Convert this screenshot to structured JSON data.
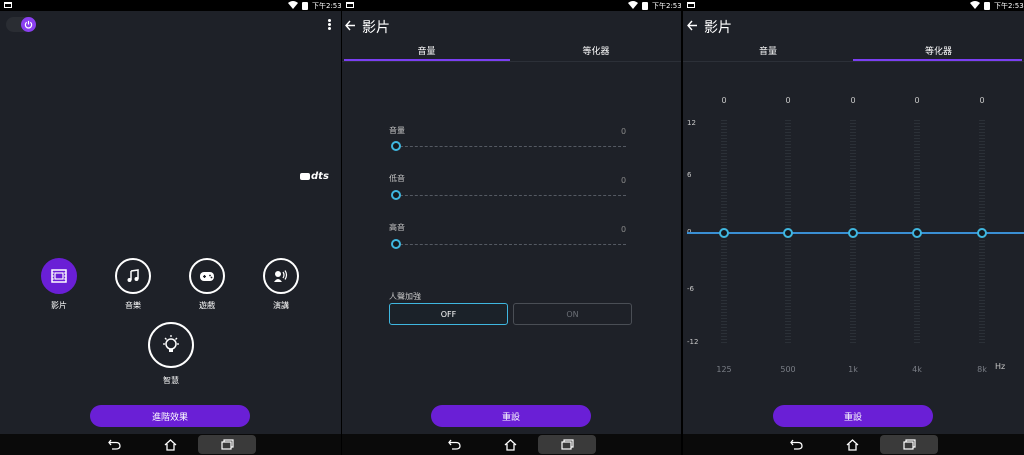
{
  "status": {
    "time": "下午2:53"
  },
  "accent": "#6a1fd6",
  "panel1": {
    "logo": "dts",
    "apps": [
      {
        "label": "影片",
        "icon": "film-icon"
      },
      {
        "label": "音樂",
        "icon": "music-note-icon"
      },
      {
        "label": "遊戲",
        "icon": "gamepad-icon"
      },
      {
        "label": "演講",
        "icon": "speaker-voice-icon"
      },
      {
        "label": "智慧",
        "icon": "lightbulb-icon"
      }
    ],
    "advanced_button": "進階效果"
  },
  "panel2": {
    "title": "影片",
    "tabs": [
      {
        "label": "音量"
      },
      {
        "label": "等化器"
      }
    ],
    "sliders": [
      {
        "label": "音量",
        "value": "0"
      },
      {
        "label": "低音",
        "value": "0"
      },
      {
        "label": "高音",
        "value": "0"
      }
    ],
    "voice_enhance": {
      "label": "人聲加強",
      "off": "OFF",
      "on": "ON"
    },
    "reset_button": "重設"
  },
  "panel3": {
    "title": "影片",
    "tabs": [
      {
        "label": "音量"
      },
      {
        "label": "等化器"
      }
    ],
    "eq_values": [
      "0",
      "0",
      "0",
      "0",
      "0"
    ],
    "y_ticks": [
      "12",
      "6",
      "0",
      "-6",
      "-12"
    ],
    "bands": [
      "125",
      "500",
      "1k",
      "4k",
      "8k"
    ],
    "unit": "Hz",
    "reset_button": "重設"
  }
}
